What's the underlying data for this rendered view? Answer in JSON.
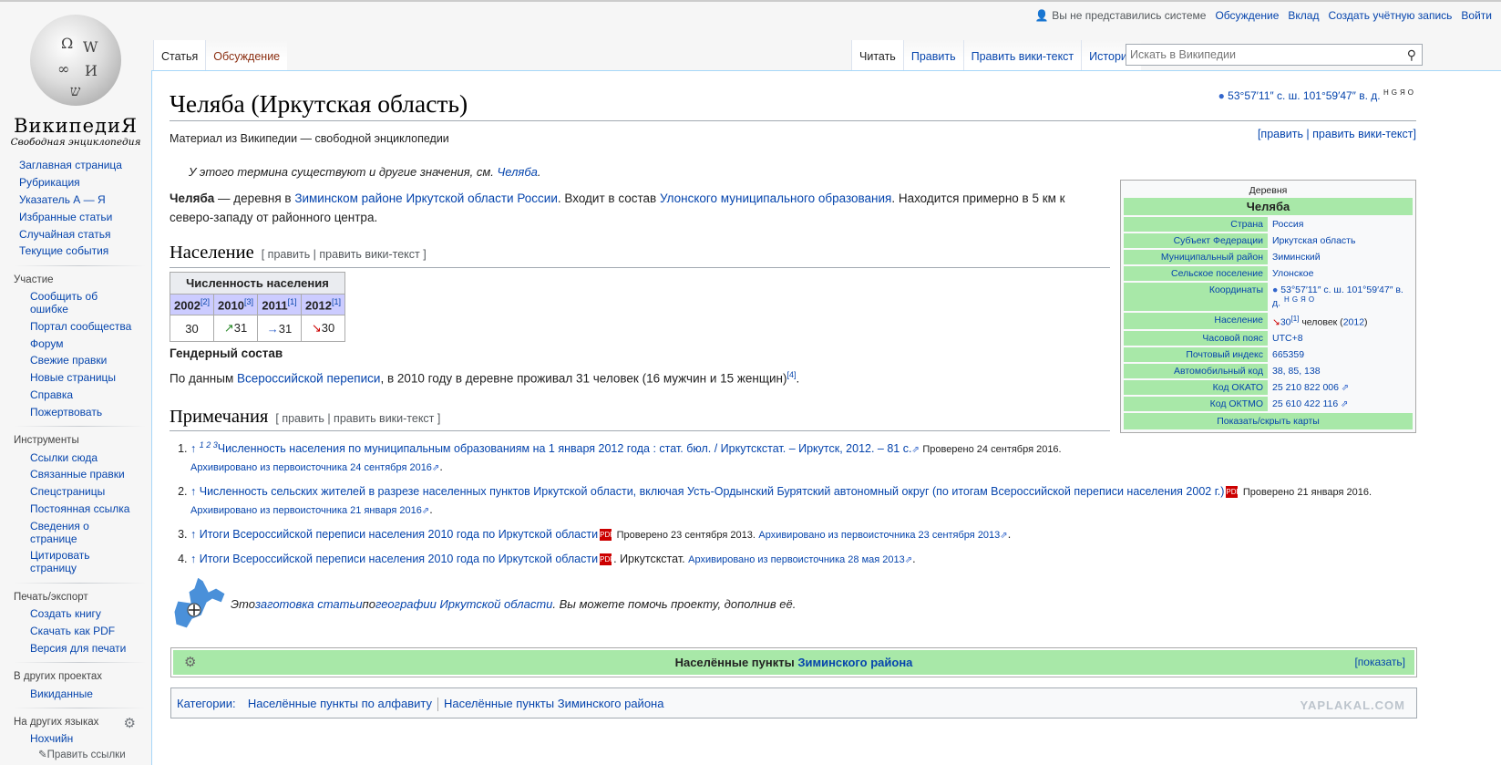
{
  "logo": {
    "title": "ВикипедиЯ",
    "subtitle": "Свободная энциклопедия"
  },
  "personal": {
    "not_logged": "Вы не представились системе",
    "talk": "Обсуждение",
    "contrib": "Вклад",
    "create": "Создать учётную запись",
    "login": "Войти"
  },
  "tabs": {
    "article": "Статья",
    "discussion": "Обсуждение",
    "read": "Читать",
    "edit": "Править",
    "edit_source": "Править вики-текст",
    "history": "История"
  },
  "search": {
    "placeholder": "Искать в Википедии"
  },
  "sidebar": {
    "main": [
      "Заглавная страница",
      "Рубрикация",
      "Указатель А — Я",
      "Избранные статьи",
      "Случайная статья",
      "Текущие события"
    ],
    "participation_title": "Участие",
    "participation": [
      "Сообщить об ошибке",
      "Портал сообщества",
      "Форум",
      "Свежие правки",
      "Новые страницы",
      "Справка",
      "Пожертвовать"
    ],
    "tools_title": "Инструменты",
    "tools": [
      "Ссылки сюда",
      "Связанные правки",
      "Спецстраницы",
      "Постоянная ссылка",
      "Сведения о странице",
      "Цитировать страницу"
    ],
    "print_title": "Печать/экспорт",
    "print": [
      "Создать книгу",
      "Скачать как PDF",
      "Версия для печати"
    ],
    "projects_title": "В других проектах",
    "projects": [
      "Викиданные"
    ],
    "languages_title": "На других языках",
    "languages": [
      "Нохчийн"
    ],
    "edit_links": "Править ссылки"
  },
  "article": {
    "title": "Челяба (Иркутская область)",
    "coords": "53°57′11″ с. ш. 101°59′47″ в. д.",
    "coords_tags": "HGЯO",
    "from_wiki": "Материал из Википедии — свободной энциклопедии",
    "edit_top": "[править | править вики-текст]",
    "hatnote_prefix": "У этого термина существуют и другие значения, см. ",
    "hatnote_link": "Челяба",
    "hatnote_suffix": ".",
    "lead": {
      "bold": "Челяба",
      "t1": " — деревня в ",
      "l1": "Зиминском районе",
      "t2": " ",
      "l2": "Иркутской области",
      "t3": " ",
      "l3": "России",
      "t4": ". Входит в состав ",
      "l4": "Улонского муниципального образования",
      "t5": ". Находится примерно в 5 км к северо-западу от районного центра."
    },
    "population_heading": "Население",
    "edit_sec": "[ править | править вики-текст ]",
    "pop_table": {
      "caption": "Численность населения",
      "years": [
        "2002",
        "2010",
        "2011",
        "2012"
      ],
      "refs": [
        "[2]",
        "[3]",
        "[1]",
        "[1]"
      ],
      "values": [
        "30",
        "31",
        "31",
        "30"
      ],
      "arrows": [
        "",
        "↗",
        "→",
        "↘"
      ],
      "arrow_colors": [
        "",
        "#2a8a2a",
        "#3366cc",
        "#cc0000"
      ]
    },
    "gender_heading": "Гендерный состав",
    "census_prefix": "По данным ",
    "census_link": "Всероссийской переписи",
    "census_text": ", в 2010 году в деревне проживал 31 человек (16 мужчин и 15 женщин)",
    "census_ref": "[4]",
    "census_end": ".",
    "notes_heading": "Примечания",
    "notes": [
      {
        "marker": "↑ ",
        "sup": "1 2 3",
        "link": "Численность населения по муниципальным образованиям на 1 января 2012 года : стат. бюл. / Иркутскстат. – Иркутск, 2012. – 81 с.",
        "checked": "Проверено 24 сентября 2016.",
        "archived": "Архивировано из первоисточника 24 сентября 2016"
      },
      {
        "marker": "↑ ",
        "link": "Численность сельских жителей в разрезе населенных пунктов Иркутской области, включая Усть-Ордынский Бурятский автономный округ (по итогам Всероссийской переписи населения 2002 г.)",
        "checked": "Проверено 21 января 2016.",
        "archived": "Архивировано из первоисточника 21 января 2016"
      },
      {
        "marker": "↑ ",
        "link": "Итоги Всероссийской переписи населения 2010 года по Иркутской области",
        "checked": "Проверено 23 сентября 2013.",
        "archived": "Архивировано из первоисточника 23 сентября 2013"
      },
      {
        "marker": "↑ ",
        "link": "Итоги Всероссийской переписи населения 2010 года по Иркутской области",
        "checked": "Иркутскстат.",
        "archived": "Архивировано из первоисточника 28 мая 2013"
      }
    ],
    "stub": {
      "t1": "Это ",
      "l1": "заготовка статьи",
      "t2": " по ",
      "l2": "географии Иркутской области",
      "t3": ". Вы можете помочь проекту, дополнив её."
    },
    "navbox": {
      "prefix": "Населённые пункты ",
      "link": "Зиминского района",
      "show": "[показать]"
    },
    "categories": {
      "label": "Категории:",
      "items": [
        "Населённые пункты по алфавиту",
        "Населённые пункты Зиминского района"
      ]
    },
    "watermark": "YAPLAKAL.COM"
  },
  "infobox": {
    "type": "Деревня",
    "name": "Челяба",
    "rows": [
      {
        "k": "Страна",
        "v": "Россия"
      },
      {
        "k": "Субъект Федерации",
        "v": "Иркутская область"
      },
      {
        "k": "Муниципальный район",
        "v": "Зиминский"
      },
      {
        "k": "Сельское поселение",
        "v": "Улонское"
      },
      {
        "k": "Координаты",
        "v": "53°57′11″ с. ш. 101°59′47″ в. д.",
        "tags": "HGЯO"
      },
      {
        "k": "Население",
        "v": "30",
        "ref": "[1]",
        "rest": " человек (",
        "year": "2012",
        ")": ")"
      },
      {
        "k": "Часовой пояс",
        "v": "UTC+8"
      },
      {
        "k": "Почтовый индекс",
        "v": "665359"
      },
      {
        "k": "Автомобильный код",
        "v": "38, 85, 138"
      },
      {
        "k": "Код ОКАТО",
        "v": "25 210 822 006"
      },
      {
        "k": "Код ОКТМО",
        "v": "25 610 422 116"
      }
    ],
    "toggle": "Показать/скрыть карты"
  }
}
